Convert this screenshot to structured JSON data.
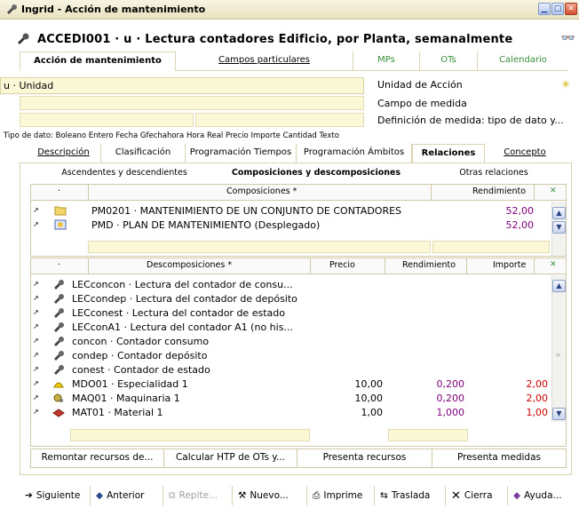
{
  "window": {
    "title": "Ingrid - Acción de mantenimiento"
  },
  "header": {
    "title": "ACCEDI001 · u · Lectura contadores Edificio, por Planta, semanalmente"
  },
  "main_tabs": [
    "Acción de mantenimiento",
    "Campos particulares",
    "MPs",
    "OTs",
    "Calendario"
  ],
  "unit_field": {
    "value": "u · Unidad"
  },
  "right_labels": [
    "Unidad de Acción",
    "Campo de medida",
    "Definición de medida: tipo de dato y..."
  ],
  "tipo_dato": "Tipo de dato: Boleano Entero Fecha Gfechahora Hora Real Precio Importe Cantidad Texto",
  "sub_tabs": [
    "Descripción",
    "Clasificación",
    "Programación Tiempos",
    "Programación Ámbitos",
    "Relaciones",
    "Concepto"
  ],
  "rel_tabs": [
    "Ascendentes y descendientes",
    "Composiciones y descomposiciones",
    "Otras relaciones"
  ],
  "compositions": {
    "headers": {
      "dot": "·",
      "name": "Composiciones *",
      "rend": "Rendimiento"
    },
    "rows": [
      {
        "name": "PM0201 · MANTENIMIENTO DE UN CONJUNTO DE CONTADORES",
        "rend": "52,00",
        "icon": "folder-icon"
      },
      {
        "name": "PMD · PLAN DE MANTENIMIENTO (Desplegado)",
        "rend": "52,00",
        "icon": "plan-icon"
      }
    ]
  },
  "decompositions": {
    "headers": {
      "dot": "·",
      "name": "Descomposiciones *",
      "precio": "Precio",
      "rend": "Rendimiento",
      "importe": "Importe"
    },
    "rows": [
      {
        "name": "LECconcon · Lectura del contador de consu...",
        "precio": "",
        "rend": "",
        "importe": "",
        "icon": "pipe-icon"
      },
      {
        "name": "LECcondep · Lectura del contador de depósito",
        "precio": "",
        "rend": "",
        "importe": "",
        "icon": "pipe-icon"
      },
      {
        "name": "LECconest · Lectura del contador de estado",
        "precio": "",
        "rend": "",
        "importe": "",
        "icon": "pipe-icon"
      },
      {
        "name": "LECconA1 · Lectura del contador A1 (no his...",
        "precio": "",
        "rend": "",
        "importe": "",
        "icon": "pipe-icon"
      },
      {
        "name": "concon · Contador consumo",
        "precio": "",
        "rend": "",
        "importe": "",
        "icon": "pipe-icon"
      },
      {
        "name": "condep · Contador depósito",
        "precio": "",
        "rend": "",
        "importe": "",
        "icon": "pipe-icon"
      },
      {
        "name": "conest · Contador de estado",
        "precio": "",
        "rend": "",
        "importe": "",
        "icon": "pipe-icon"
      },
      {
        "name": "MDO01 · Especialidad 1",
        "precio": "10,00",
        "rend": "0,200",
        "importe": "2,00",
        "icon": "worker-icon"
      },
      {
        "name": "MAQ01 · Maquinaria 1",
        "precio": "10,00",
        "rend": "0,200",
        "importe": "2,00",
        "icon": "machine-icon"
      },
      {
        "name": "MAT01 · Material 1",
        "precio": "1,00",
        "rend": "1,000",
        "importe": "1,00",
        "icon": "brick-icon"
      }
    ]
  },
  "action_buttons": [
    "Remontar recursos de...",
    "Calcular HTP de OTs y...",
    "Presenta recursos",
    "Presenta medidas"
  ],
  "bottom_buttons": [
    "Siguiente",
    "Anterior",
    "Repite...",
    "Nuevo...",
    "Imprime",
    "Traslada",
    "Cierra",
    "Ayuda..."
  ],
  "colors": {
    "accent_yellow": "#fbf8d8",
    "green_tab": "#3b8f3b",
    "purple_value": "#800080",
    "red_value": "#d00000"
  }
}
